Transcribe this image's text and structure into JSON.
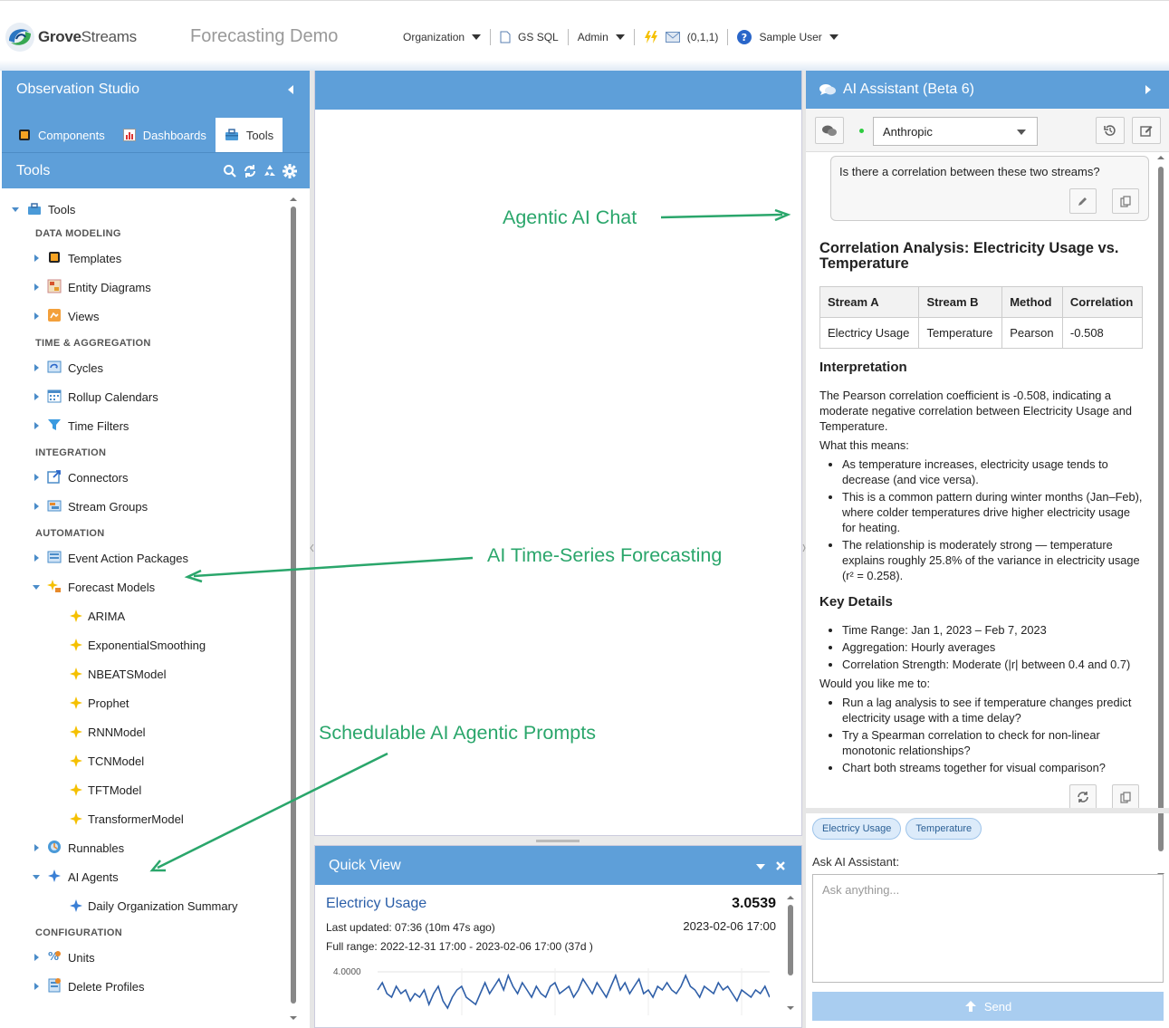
{
  "header": {
    "brand_strong": "Grove",
    "brand_rest": "Streams",
    "app_title": "Forecasting Demo",
    "nav": {
      "organization": "Organization",
      "gs_sql": "GS SQL",
      "admin": "Admin",
      "counts": "(0,1,1)",
      "user": "Sample User"
    }
  },
  "left_panel": {
    "title": "Observation Studio",
    "tabs": [
      {
        "label": "Components"
      },
      {
        "label": "Dashboards"
      },
      {
        "label": "Tools"
      }
    ],
    "tools_title": "Tools",
    "tree_root": "Tools",
    "sections": {
      "data_modeling": "DATA MODELING",
      "time_aggregation": "TIME & AGGREGATION",
      "integration": "INTEGRATION",
      "automation": "AUTOMATION",
      "configuration": "CONFIGURATION"
    },
    "items": {
      "templates": "Templates",
      "entity_diagrams": "Entity Diagrams",
      "views": "Views",
      "cycles": "Cycles",
      "rollup_calendars": "Rollup Calendars",
      "time_filters": "Time Filters",
      "connectors": "Connectors",
      "stream_groups": "Stream Groups",
      "event_action_packages": "Event Action Packages",
      "forecast_models": "Forecast Models",
      "runnables": "Runnables",
      "ai_agents": "AI Agents",
      "units": "Units",
      "delete_profiles": "Delete Profiles"
    },
    "forecast_children": [
      "ARIMA",
      "ExponentialSmoothing",
      "NBEATSModel",
      "Prophet",
      "RNNModel",
      "TCNModel",
      "TFTModel",
      "TransformerModel"
    ],
    "agent_children": [
      "Daily Organization Summary"
    ]
  },
  "quick_view": {
    "title": "Quick View",
    "stream_name": "Electricy Usage",
    "value": "3.0539",
    "last_updated": "Last updated: 07:36 (10m 47s ago)",
    "timestamp": "2023-02-06 17:00",
    "full_range": "Full range: 2022-12-31 17:00 - 2023-02-06 17:00 (37d )",
    "y_tick": "4.0000"
  },
  "chart_data": {
    "type": "line",
    "title": "",
    "series": [
      {
        "values": [
          3.5,
          3.7,
          3.4,
          3.3,
          3.6,
          3.4,
          3.5,
          3.2,
          3.4,
          3.3,
          3.5,
          3.1,
          3.4,
          3.6,
          3.2,
          3.0,
          3.3,
          3.5,
          3.6,
          3.3,
          3.2,
          3.1,
          3.4,
          3.7,
          3.4,
          3.6,
          3.8,
          3.5,
          3.9,
          3.6,
          3.4,
          3.7,
          3.5,
          3.3,
          3.6,
          3.4,
          3.3,
          3.6,
          3.7,
          3.4,
          3.5,
          3.6,
          3.3,
          3.5,
          3.8,
          3.6,
          3.4,
          3.7,
          3.5,
          3.3,
          3.6,
          3.9,
          3.5,
          3.7,
          3.4,
          3.6,
          3.8,
          3.4,
          3.5,
          3.3,
          3.6,
          3.5,
          3.7,
          3.5,
          3.4,
          3.6,
          3.9,
          3.6,
          3.5,
          3.3,
          3.6,
          3.5,
          3.4,
          3.7,
          3.5,
          3.6,
          3.4,
          3.2,
          3.5,
          3.4,
          3.3,
          3.5,
          3.4,
          3.6,
          3.3
        ]
      }
    ],
    "yticks": [
      "4.0000"
    ],
    "ylim": [
      2.8,
      4.1
    ],
    "color": "#2f5fa8"
  },
  "ai_panel": {
    "title": "AI Assistant (Beta 6)",
    "provider": "Anthropic",
    "user_prompt": "Is there a correlation between these two streams?",
    "response": {
      "heading": "Correlation Analysis: Electricity Usage vs. Temperature",
      "table_headers": [
        "Stream A",
        "Stream B",
        "Method",
        "Correlation"
      ],
      "table_row": [
        "Electricy Usage",
        "Temperature",
        "Pearson",
        "-0.508"
      ],
      "interp_heading": "Interpretation",
      "interp_text": "The Pearson correlation coefficient is -0.508, indicating a moderate negative correlation between Electricity Usage and Temperature.",
      "means_label": "What this means:",
      "means": [
        "As temperature increases, electricity usage tends to decrease (and vice versa).",
        "This is a common pattern during winter months (Jan–Feb), where colder temperatures drive higher electricity usage for heating.",
        "The relationship is moderately strong — temperature explains roughly 25.8% of the variance in electricity usage (r² = 0.258)."
      ],
      "details_heading": "Key Details",
      "details": [
        "Time Range: Jan 1, 2023 – Feb 7, 2023",
        "Aggregation: Hourly averages",
        "Correlation Strength: Moderate (|r| between 0.4 and 0.7)"
      ],
      "follow_label": "Would you like me to:",
      "follow": [
        "Run a lag analysis to see if temperature changes predict electricity usage with a time delay?",
        "Try a Spearman correlation to check for non-linear monotonic relationships?",
        "Chart both streams together for visual comparison?"
      ]
    },
    "chips": [
      "Electricy Usage",
      "Temperature"
    ],
    "ask_label": "Ask AI Assistant:",
    "ask_placeholder": "Ask anything...",
    "send_label": "Send"
  },
  "annotations": {
    "chat": "Agentic AI Chat",
    "forecasting": "AI Time-Series Forecasting",
    "prompts": "Schedulable AI Agentic Prompts",
    "color": "#2aa66b"
  }
}
